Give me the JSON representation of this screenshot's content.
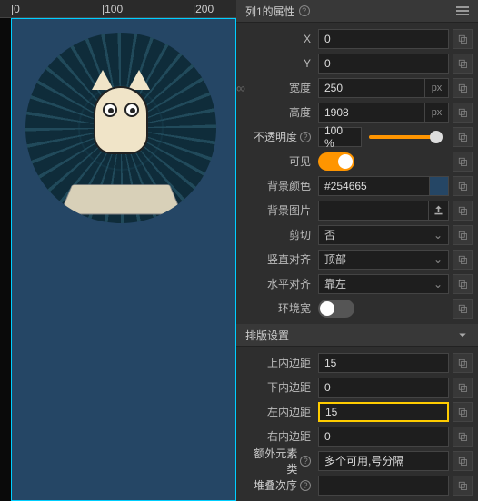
{
  "ruler": {
    "m0": "|0",
    "m100": "|100",
    "m200": "|200"
  },
  "panel1": {
    "title": "列1的属性",
    "x_label": "X",
    "x": "0",
    "y_label": "Y",
    "y": "0",
    "width_label": "宽度",
    "width": "250",
    "px": "px",
    "height_label": "高度",
    "height": "1908",
    "opacity_label": "不透明度",
    "opacity": "100 %",
    "opacity_pct": 92,
    "visible_label": "可见",
    "bgcolor_label": "背景颜色",
    "bgcolor": "#254665",
    "bgimg_label": "背景图片",
    "bgimg": "",
    "clip_label": "剪切",
    "clip": "否",
    "valign_label": "竖直对齐",
    "valign": "顶部",
    "halign_label": "水平对齐",
    "halign": "靠左",
    "envwidth_label": "环境宽"
  },
  "panel2": {
    "title": "排版设置",
    "pt_label": "上内边距",
    "pt": "15",
    "pb_label": "下内边距",
    "pb": "0",
    "pl_label": "左内边距",
    "pl": "15",
    "pr_label": "右内边距",
    "pr": "0",
    "extra_label": "额外元素类",
    "extra_ph": "多个可用,号分隔",
    "stack_label": "堆叠次序"
  }
}
